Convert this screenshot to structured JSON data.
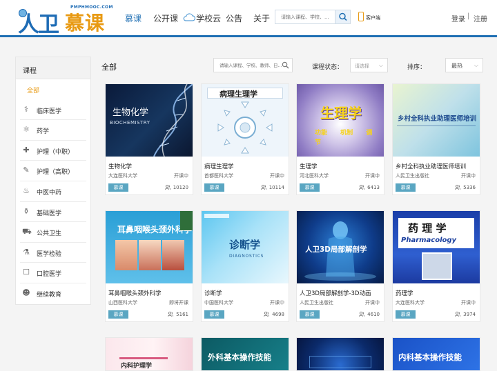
{
  "header": {
    "logo_main": "人卫",
    "logo_sub": "PMPHMOOC.COM",
    "logo_title": "慕课",
    "nav": [
      {
        "label": "慕课",
        "active": true
      },
      {
        "label": "公开课",
        "active": false
      },
      {
        "label": "学校云",
        "active": false
      },
      {
        "label": "公告",
        "active": false
      },
      {
        "label": "关于",
        "active": false
      }
    ],
    "search_placeholder": "请输入课程、学校、...",
    "client_label": "客户端",
    "login": "登录",
    "separator": "|",
    "register": "注册",
    "accent": "#1f6fb3"
  },
  "sidebar": {
    "heading": "课程",
    "items": [
      {
        "label": "全部",
        "icon": "none"
      },
      {
        "label": "临床医学",
        "icon": "stethoscope-icon"
      },
      {
        "label": "药学",
        "icon": "molecule-icon"
      },
      {
        "label": "护理（中职）",
        "icon": "nurse-icon"
      },
      {
        "label": "护理（高职）",
        "icon": "syringe-icon"
      },
      {
        "label": "中医中药",
        "icon": "herb-pot-icon"
      },
      {
        "label": "基础医学",
        "icon": "bottle-icon"
      },
      {
        "label": "公共卫生",
        "icon": "ambulance-icon"
      },
      {
        "label": "医学检验",
        "icon": "flask-icon"
      },
      {
        "label": "口腔医学",
        "icon": "tooth-icon"
      },
      {
        "label": "继续教育",
        "icon": "graduate-icon"
      }
    ],
    "active_color": "#e89a13"
  },
  "toolbar": {
    "crumb": "全部",
    "search_placeholder": "请输入课程、学校、教师、日...",
    "status_label": "课程状态：",
    "status_value": "请选择",
    "sort_label": "排序：",
    "sort_value": "最热"
  },
  "courses": [
    {
      "title": "生物化学",
      "school": "大连医科大学",
      "state": "开课中",
      "tag": "慕课",
      "users": "10120",
      "cover_text": "生物化学",
      "cover_sub": "BIOCHEMISTRY"
    },
    {
      "title": "病理生理学",
      "school": "首都医科大学",
      "state": "开课中",
      "tag": "慕课",
      "users": "10114",
      "cover_text": "病理生理学",
      "cover_sub": ""
    },
    {
      "title": "生理学",
      "school": "河北医科大学",
      "state": "开课中",
      "tag": "慕课",
      "users": "6413",
      "cover_text": "生理学",
      "cover_sub": "功能 机制 调节"
    },
    {
      "title": "乡村全科执业助理医师培训",
      "school": "人民卫生出版社",
      "state": "开课中",
      "tag": "慕课",
      "users": "5336",
      "cover_text": "乡村全科执业助理医师培训",
      "cover_sub": ""
    },
    {
      "title": "耳鼻咽喉头颈外科学",
      "school": "山西医科大学",
      "state": "即将开课",
      "tag": "慕课",
      "users": "5161",
      "cover_text": "耳鼻咽喉头颈外科学",
      "cover_sub": ""
    },
    {
      "title": "诊断学",
      "school": "中国医科大学",
      "state": "开课中",
      "tag": "慕课",
      "users": "4698",
      "cover_text": "诊断学",
      "cover_sub": "DIAGNOSTICS"
    },
    {
      "title": "人卫3D局部解剖学-3D动画",
      "school": "人民卫生出版社",
      "state": "开课中",
      "tag": "慕课",
      "users": "4610",
      "cover_text": "人卫3D局部解剖学",
      "cover_sub": ""
    },
    {
      "title": "药理学",
      "school": "大连医科大学",
      "state": "开课中",
      "tag": "慕课",
      "users": "3974",
      "cover_text": "药 理 学",
      "cover_sub": "Pharmacology"
    },
    {
      "title": "",
      "school": "",
      "state": "",
      "tag": "",
      "users": "",
      "cover_text": "内科护理学",
      "cover_sub": ""
    },
    {
      "title": "",
      "school": "",
      "state": "",
      "tag": "",
      "users": "",
      "cover_text": "外科基本操作技能",
      "cover_sub": ""
    },
    {
      "title": "",
      "school": "",
      "state": "",
      "tag": "",
      "users": "",
      "cover_text": "",
      "cover_sub": ""
    },
    {
      "title": "",
      "school": "",
      "state": "",
      "tag": "",
      "users": "",
      "cover_text": "内科基本操作技能",
      "cover_sub": ""
    }
  ],
  "tag_color": "#5aa6c2"
}
